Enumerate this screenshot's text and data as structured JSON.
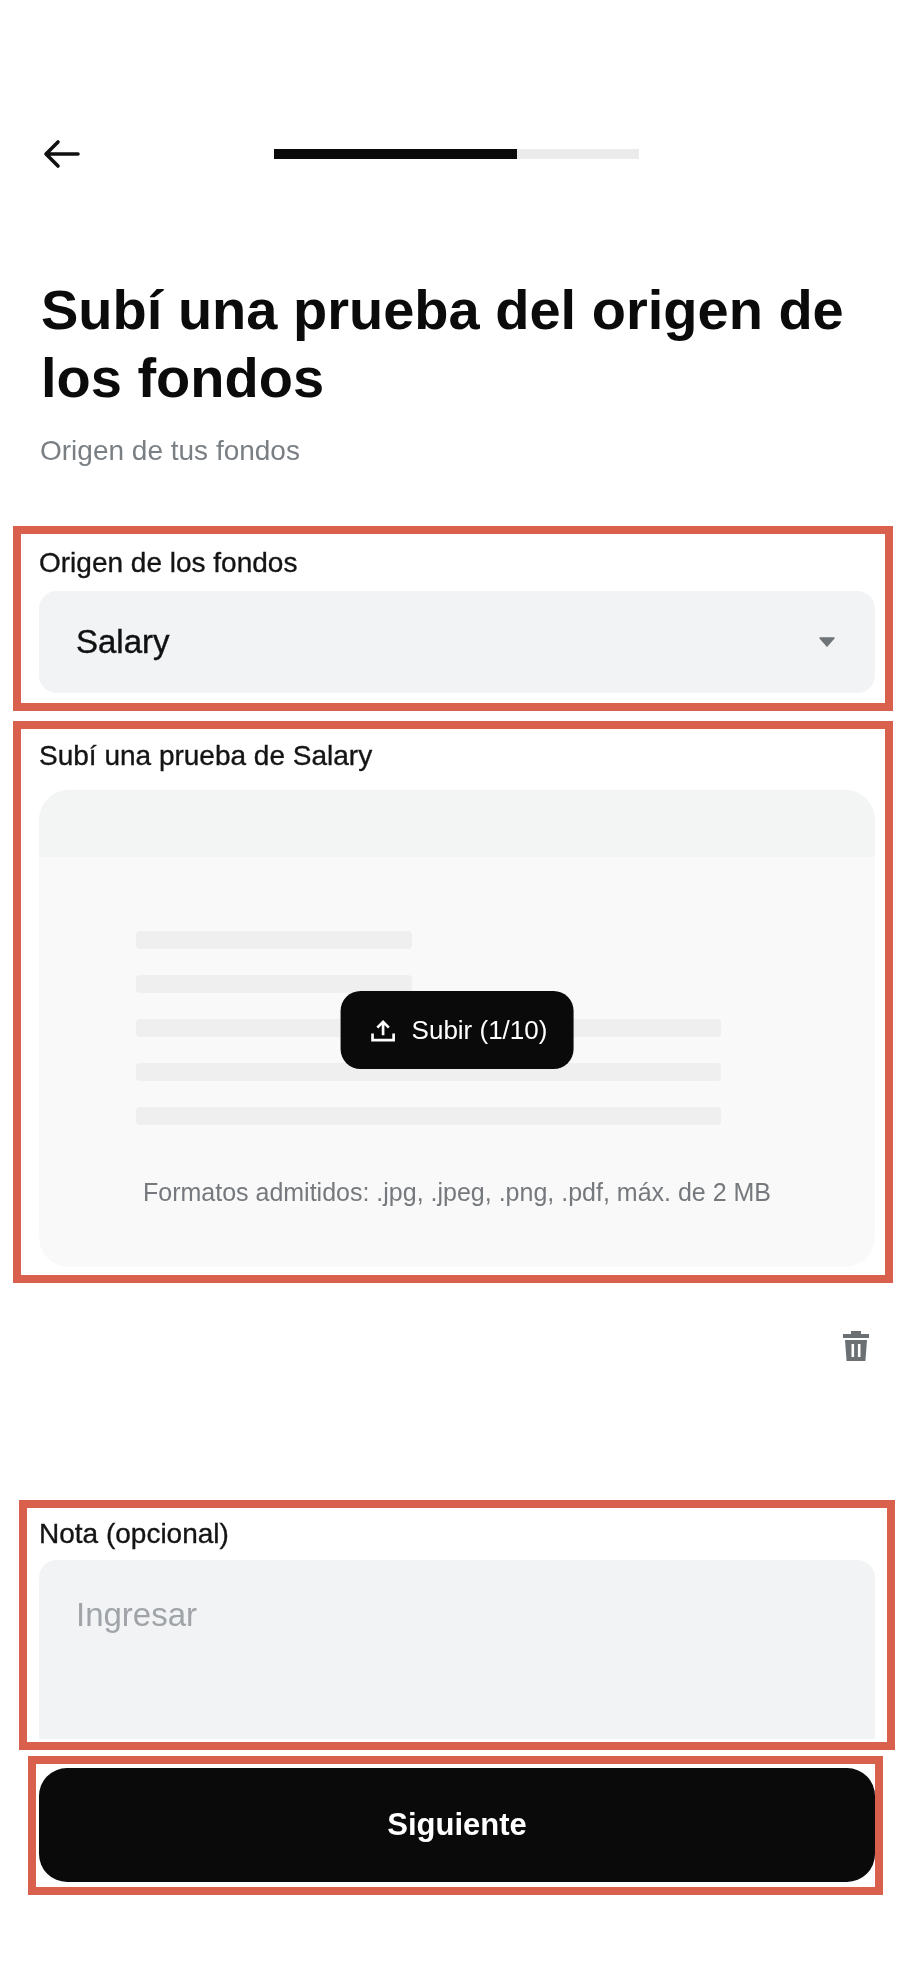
{
  "progress": {
    "level": 0.667
  },
  "title": "Subí una prueba del origen de los fondos",
  "subtitle": "Origen de tus fondos",
  "sections": [
    {
      "kind": "select",
      "highlighted": true,
      "label": "Origen de los fondos",
      "value": "Salary"
    },
    {
      "kind": "upload",
      "highlighted": true,
      "label": "Subí una prueba de Salary",
      "upload_button": "Subir (1/10)",
      "hint": "Formatos admitidos: .jpg, .jpeg, .png, .pdf, máx. de 2 MB"
    },
    {
      "kind": "textarea",
      "highlighted": true,
      "label": "Nota (opcional)",
      "placeholder": "Ingresar"
    }
  ],
  "next_button": {
    "label": "Siguiente",
    "highlighted": true
  }
}
